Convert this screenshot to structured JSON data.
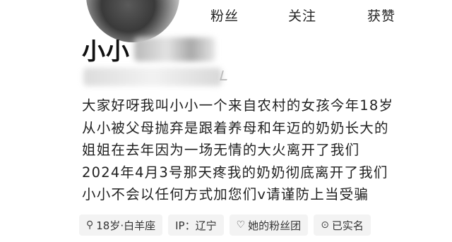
{
  "stats": [
    {
      "label": "粉丝"
    },
    {
      "label": "关注"
    },
    {
      "label": "获赞"
    }
  ],
  "profile": {
    "name": "小小"
  },
  "bio": [
    "大家好呀我叫小小一个来自农村的女孩今年18岁",
    "从小被父母抛弃是跟着养母和年迈的奶奶长大的",
    "姐姐在去年因为一场无情的大火离开了我们",
    "2024年4月3号那天疼我的奶奶彻底离开了我们",
    "小小不会以任何方式加您们v请谨防上当受骗"
  ],
  "tags": [
    {
      "icon": "search-icon",
      "glyph": "⚲",
      "text": "18岁·白羊座"
    },
    {
      "icon": "",
      "glyph": "",
      "text": "IP：辽宁"
    },
    {
      "icon": "heart-icon",
      "glyph": "♡",
      "text": "她的粉丝团"
    },
    {
      "icon": "verified-icon",
      "glyph": "⊙",
      "text": "已实名"
    }
  ]
}
